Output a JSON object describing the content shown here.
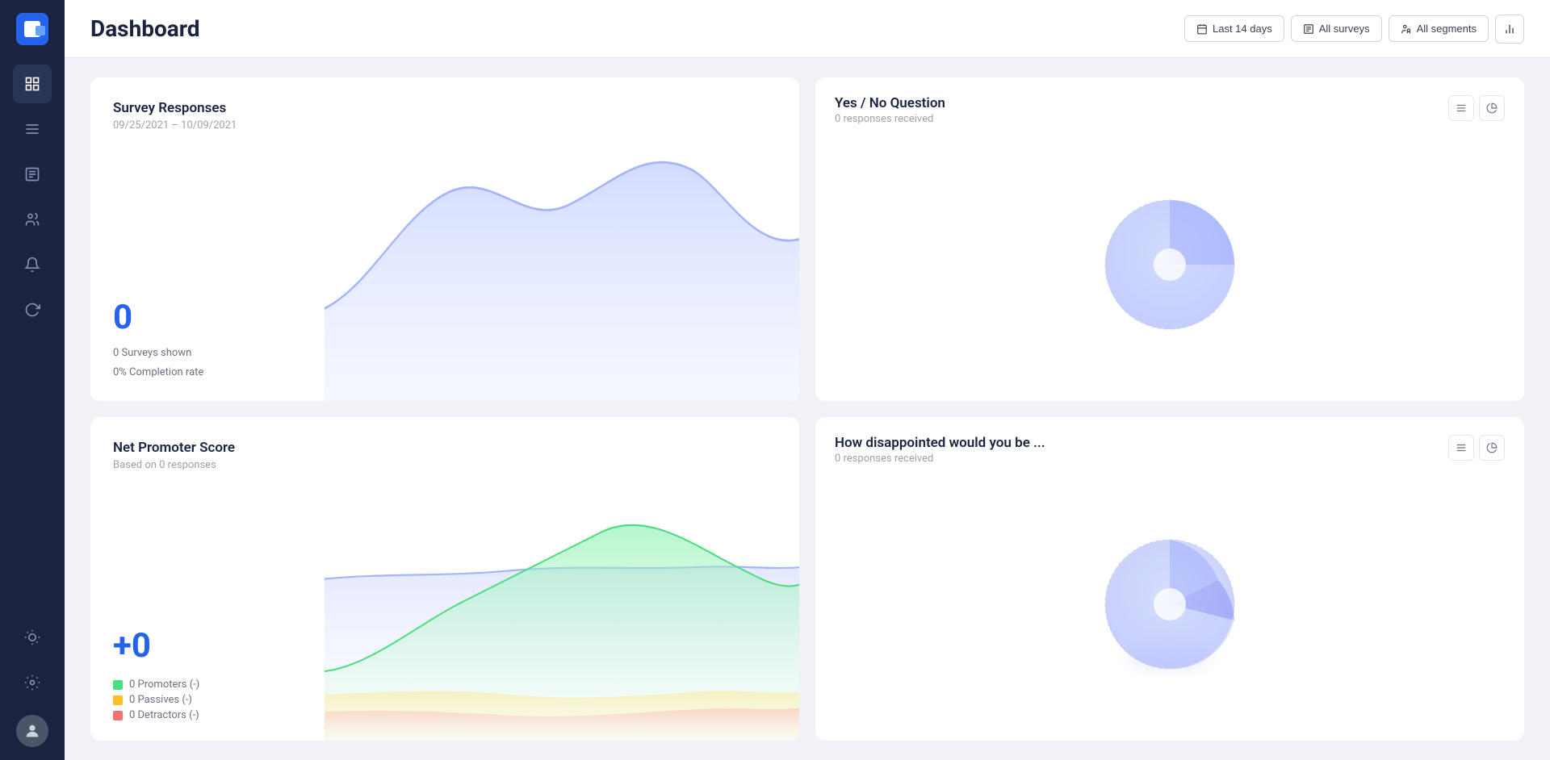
{
  "app": {
    "logo_alt": "App Logo"
  },
  "header": {
    "title": "Dashboard",
    "controls": {
      "date_range": "Last 14 days",
      "surveys": "All surveys",
      "segments": "All segments"
    }
  },
  "sidebar": {
    "items": [
      {
        "id": "dashboard",
        "icon": "📊",
        "active": true
      },
      {
        "id": "menu",
        "icon": "☰",
        "active": false
      },
      {
        "id": "reports",
        "icon": "📋",
        "active": false
      },
      {
        "id": "users",
        "icon": "👥",
        "active": false
      },
      {
        "id": "notifications",
        "icon": "🔔",
        "active": false
      },
      {
        "id": "refresh",
        "icon": "🔄",
        "active": false
      }
    ],
    "bottom_items": [
      {
        "id": "settings-light",
        "icon": "💡"
      },
      {
        "id": "settings",
        "icon": "⚙️"
      }
    ]
  },
  "survey_responses": {
    "title": "Survey Responses",
    "date_range": "09/25/2021 – 10/09/2021",
    "count": "0",
    "surveys_shown": "0 Surveys shown",
    "completion_rate": "0% Completion rate"
  },
  "nps": {
    "title": "Net Promoter Score",
    "subtitle": "Based on 0 responses",
    "score": "0",
    "promoters": "0 Promoters (-)",
    "passives": "0 Passives (-)",
    "detractors": "0 Detractors (-)",
    "promoters_color": "#4ade80",
    "passives_color": "#fbbf24",
    "detractors_color": "#f87171"
  },
  "yes_no": {
    "title": "Yes / No Question",
    "subtitle": "0 responses received",
    "list_icon": "≡",
    "chart_icon": "◑"
  },
  "disappointed": {
    "title": "How disappointed would you be ...",
    "subtitle": "0 responses received",
    "list_icon": "≡",
    "chart_icon": "◑"
  }
}
